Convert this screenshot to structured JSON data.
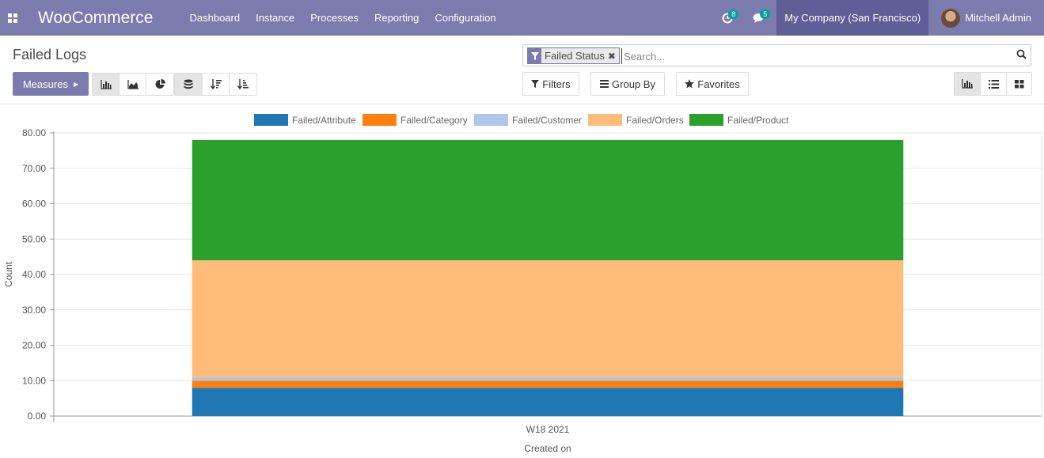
{
  "navbar": {
    "brand": "WooCommerce",
    "menu": [
      "Dashboard",
      "Instance",
      "Processes",
      "Reporting",
      "Configuration"
    ],
    "activity_count": "8",
    "message_count": "5",
    "company": "My Company (San Francisco)",
    "user": "Mitchell Admin"
  },
  "control_panel": {
    "title": "Failed Logs",
    "facet_label": "Failed Status",
    "search_placeholder": "Search...",
    "measures_label": "Measures",
    "filters_label": "Filters",
    "group_by_label": "Group By",
    "favorites_label": "Favorites"
  },
  "icons": {
    "apps": "apps-grid-icon",
    "activity": "clock-icon",
    "messages": "chat-icon",
    "search": "search-icon",
    "bar": "bar-chart-icon",
    "line": "area-chart-icon",
    "pie": "pie-chart-icon",
    "stacked": "stack-icon",
    "sort_desc": "sort-descending-icon",
    "sort_asc": "sort-ascending-icon",
    "graph_view": "graph-view-icon",
    "list_view": "list-view-icon",
    "kanban_view": "kanban-view-icon"
  },
  "colors": {
    "navbar": "#7c7bad",
    "brand_accent": "#7c7bad"
  },
  "chart_data": {
    "type": "bar",
    "stacked": true,
    "categories": [
      "W18 2021"
    ],
    "series": [
      {
        "name": "Failed/Attribute",
        "color": "#1f77b4",
        "values": [
          8
        ]
      },
      {
        "name": "Failed/Category",
        "color": "#ff7f0e",
        "values": [
          2
        ]
      },
      {
        "name": "Failed/Customer",
        "color": "#aec7e8",
        "values": [
          1
        ]
      },
      {
        "name": "Failed/Orders",
        "color": "#ffbb78",
        "values": [
          33
        ]
      },
      {
        "name": "Failed/Product",
        "color": "#2ca02c",
        "values": [
          34
        ]
      }
    ],
    "yticks": [
      "0.00",
      "10.00",
      "20.00",
      "30.00",
      "40.00",
      "50.00",
      "60.00",
      "70.00",
      "80.00"
    ],
    "ylim": [
      0,
      80
    ],
    "xlabel": "Created on",
    "ylabel": "Count",
    "legend": "top",
    "grid": true
  }
}
